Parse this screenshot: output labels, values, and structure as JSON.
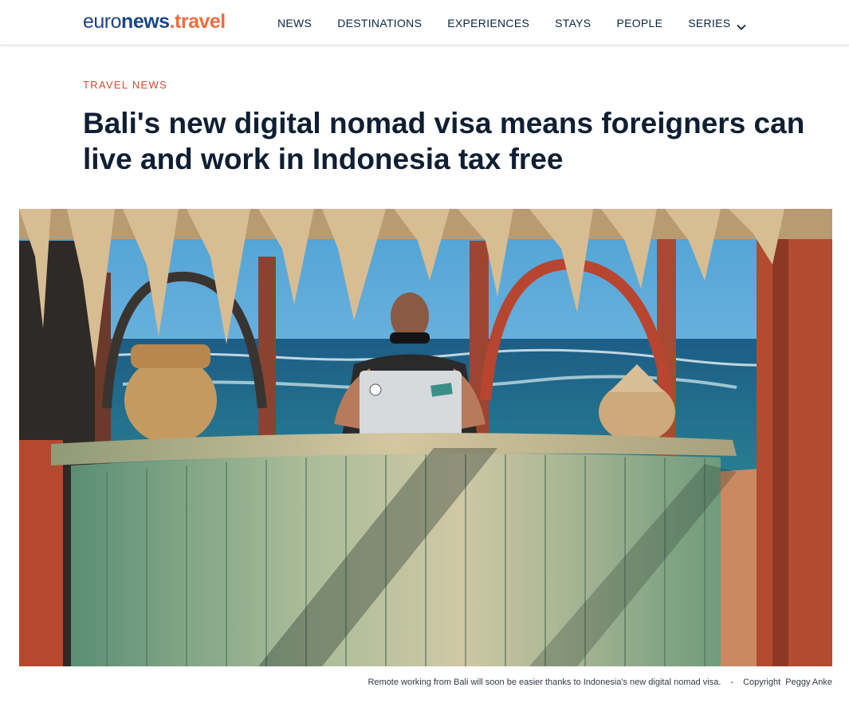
{
  "header": {
    "logo": {
      "brand_light": "euro",
      "brand_bold": "news",
      "dot": ".",
      "section": "travel"
    },
    "nav": [
      {
        "label": "NEWS"
      },
      {
        "label": "DESTINATIONS"
      },
      {
        "label": "EXPERIENCES"
      },
      {
        "label": "STAYS"
      },
      {
        "label": "PEOPLE"
      },
      {
        "label": "SERIES"
      }
    ]
  },
  "article": {
    "kicker": "TRAVEL NEWS",
    "headline": "Bali's new digital nomad visa means foreigners can live and work in Indonesia tax free",
    "image_caption": "Remote working from Bali will soon be easier thanks to Indonesia's new digital nomad visa.",
    "caption_separator": "-",
    "copyright_label": "Copyright",
    "copyright_owner": "Peggy Anke"
  },
  "colors": {
    "brand_blue": "#1c4587",
    "accent_orange": "#f06c3f",
    "kicker_red": "#d0492d",
    "headline": "#0f1f33"
  },
  "icons": {
    "series_dropdown": "chevron-down-icon"
  }
}
